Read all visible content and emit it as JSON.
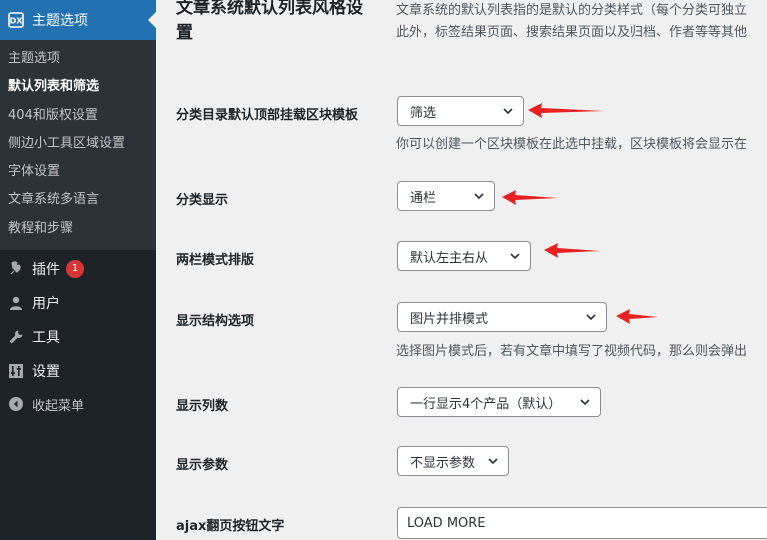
{
  "sidebar": {
    "theme_menu": "主题选项",
    "submenu": [
      "主题选项",
      "默认列表和筛选",
      "404和版权设置",
      "侧边小工具区域设置",
      "字体设置",
      "文章系统多语言",
      "教程和步骤"
    ],
    "plugins": "插件",
    "plugins_badge": "1",
    "users": "用户",
    "tools": "工具",
    "settings": "设置",
    "collapse": "收起菜单"
  },
  "main": {
    "heading": "文章系统默认列表风格设置",
    "intro_line1": "文章系统的默认列表指的是默认的分类样式（每个分类可独立",
    "intro_line2": "此外，标签结果页面、搜索结果页面以及归档、作者等等其他",
    "rows": {
      "block_template": {
        "label": "分类目录默认顶部挂载区块模板",
        "value": "筛选",
        "desc": "你可以创建一个区块模板在此选中挂载，区块模板将会显示在"
      },
      "category_display": {
        "label": "分类显示",
        "value": "通栏"
      },
      "two_column": {
        "label": "两栏模式排版",
        "value": "默认左主右从"
      },
      "structure": {
        "label": "显示结构选项",
        "value": "图片并排模式",
        "desc": "选择图片模式后，若有文章中填写了视频代码，那么则会弹出"
      },
      "columns": {
        "label": "显示列数",
        "value": "一行显示4个产品（默认）"
      },
      "params": {
        "label": "显示参数",
        "value": "不显示参数"
      },
      "ajax": {
        "label": "ajax翻页按钮文字",
        "value": "LOAD MORE"
      }
    }
  },
  "colors": {
    "accent": "#2271b1",
    "sidebar": "#1d2327",
    "arrow": "#e8201f"
  }
}
